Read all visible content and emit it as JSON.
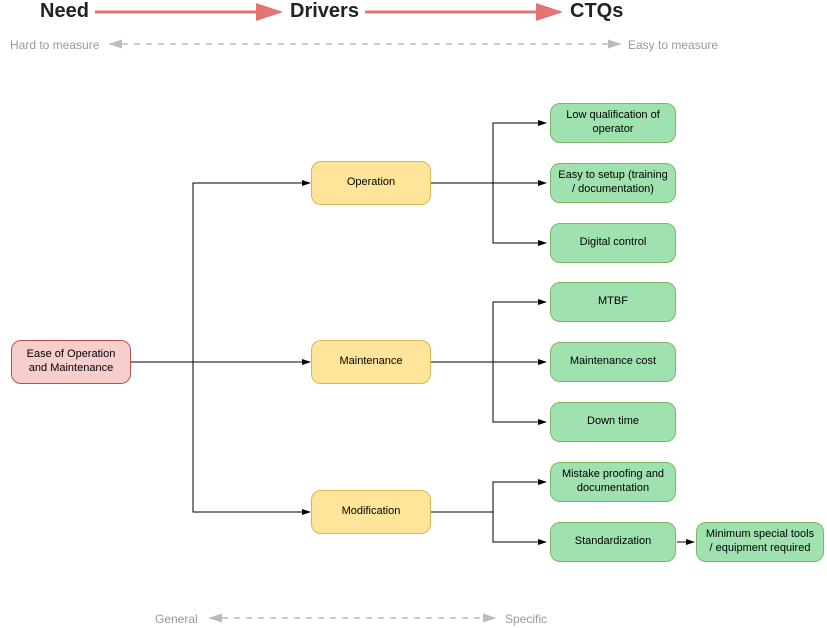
{
  "header": {
    "need": "Need",
    "drivers": "Drivers",
    "ctqs": "CTQs"
  },
  "measure": {
    "hard": "Hard to measure",
    "easy": "Easy to measure",
    "general": "General",
    "specific": "Specific"
  },
  "need": {
    "label": "Ease of Operation and Maintenance"
  },
  "drivers": {
    "operation": {
      "label": "Operation"
    },
    "maintenance": {
      "label": "Maintenance"
    },
    "modification": {
      "label": "Modification"
    }
  },
  "ctqs": {
    "low_qual": {
      "label": "Low qualification of operator"
    },
    "easy_setup": {
      "label": "Easy to setup (training / documentation)"
    },
    "digital": {
      "label": "Digital control"
    },
    "mtbf": {
      "label": "MTBF"
    },
    "maint_cost": {
      "label": "Maintenance cost"
    },
    "downtime": {
      "label": "Down time"
    },
    "mistake": {
      "label": "Mistake proofing and documentation"
    },
    "standard": {
      "label": "Standardization"
    },
    "min_tools": {
      "label": "Minimum special tools / equipment required"
    }
  }
}
